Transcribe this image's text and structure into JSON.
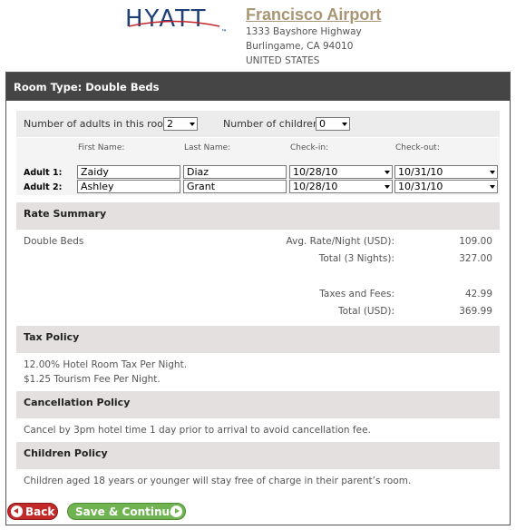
{
  "header": {
    "logo_text": "HYATT",
    "logo_tm": "™",
    "hotel_name": "Francisco Airport",
    "address_line1": "1333 Bayshore Highway",
    "address_line2": "Burlingame, CA 94010",
    "address_line3": "UNITED STATES"
  },
  "panel": {
    "title": "Room Type: Double Beds"
  },
  "occupancy": {
    "adults_label": "Number of adults in this room:",
    "adults_value": "2",
    "children_label": "Number of children:",
    "children_value": "0"
  },
  "guests": {
    "columns": [
      "First Name:",
      "Last Name:",
      "Check-in:",
      "Check-out:"
    ],
    "rows": [
      {
        "label": "Adult 1:",
        "first": "Zaidy",
        "last": "Diaz",
        "checkin": "10/28/10",
        "checkout": "10/31/10"
      },
      {
        "label": "Adult 2:",
        "first": "Ashley",
        "last": "Grant",
        "checkin": "10/28/10",
        "checkout": "10/31/10"
      }
    ]
  },
  "rate_summary": {
    "heading": "Rate Summary",
    "room": "Double Beds",
    "avg_label": "Avg. Rate/Night (USD):",
    "avg_value": "109.00",
    "total_nights_label": "Total (3 Nights):",
    "total_nights_value": "327.00",
    "taxes_label": "Taxes and Fees:",
    "taxes_value": "42.99",
    "total_label": "Total (USD):",
    "total_value": "369.99"
  },
  "tax_policy": {
    "heading": "Tax Policy",
    "line1": "12.00% Hotel Room Tax Per Night.",
    "line2": "$1.25 Tourism Fee Per Night."
  },
  "cancellation_policy": {
    "heading": "Cancellation Policy",
    "text": "Cancel by 3pm hotel time 1 day prior to arrival to avoid cancellation fee."
  },
  "children_policy": {
    "heading": "Children Policy",
    "text": "Children aged 18 years or younger will stay free of charge in their parent’s room."
  },
  "buttons": {
    "back": "Back",
    "save": "Save & Continue"
  },
  "colors": {
    "brand_blue": "#1f3f77",
    "hotel_gold": "#a89675",
    "back_red": "#c22a2a",
    "save_green": "#6fb450",
    "title_bar": "#454545"
  }
}
